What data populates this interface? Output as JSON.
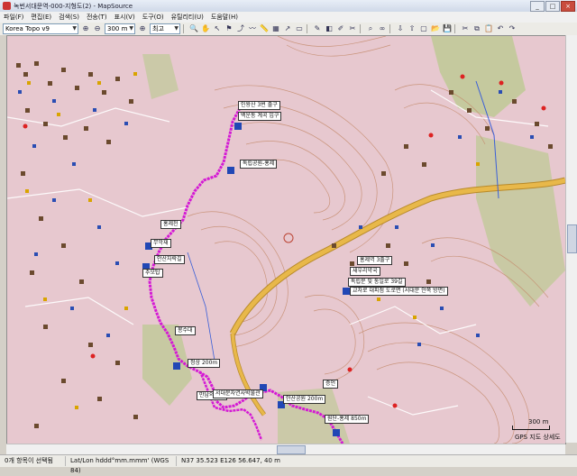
{
  "window": {
    "title": "녹번서대문역-000-지형도(2) - MapSource",
    "controls": [
      "_",
      "□",
      "×"
    ]
  },
  "menu": [
    "파일(F)",
    "편집(E)",
    "검색(S)",
    "전송(T)",
    "표시(V)",
    "도구(O)",
    "유틸리티(U)",
    "도움말(H)"
  ],
  "toolbar": {
    "product": "Korea Topo v9",
    "zoom": "300 m",
    "detail": "최고"
  },
  "map": {
    "colors": {
      "background": "#e7c8cf",
      "contour": "#c58c6e",
      "road": "#e8b84a",
      "road_edge": "#b88a2a",
      "track": "#d41ad4",
      "forest": "#b9c98e",
      "water": "#3a5fd8"
    },
    "labels": [
      "인왕산 3번 출구",
      "백운동 계곡 입구",
      "독립공원-홍제",
      "홍제천",
      "무악재",
      "안산자락길",
      "추모탑",
      "봉수대",
      "정상 200m",
      "만남의광장",
      "서대문자연사박물관",
      "안산공원 200m",
      "증언",
      "홍제역 3출구",
      "새우리약국",
      "독립문 및 통일로 39길",
      "교차로 대피점 도로면 (서대문 안쪽 방면)",
      "원단-홍제 850m"
    ],
    "scale_bar": "300 m",
    "accuracy": "GPS 지도 상세도"
  },
  "status": {
    "selection": "0개 항목이 선택됨",
    "format": "Lat/Lon hddd°mm.mmm' (WGS 84)",
    "position": "N37 35.523 E126 56.647, 40 m"
  }
}
